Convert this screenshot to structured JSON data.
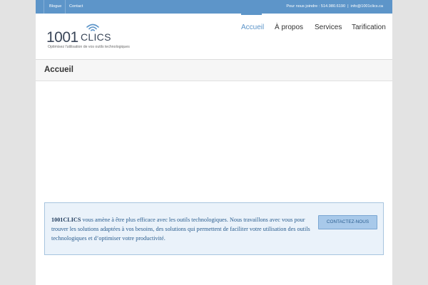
{
  "topbar": {
    "links": [
      "Blogue",
      "Contact"
    ],
    "phone_label": "Pour nous joindre : 514.980.6190",
    "separator": "|",
    "email": "info@1001clics.ca"
  },
  "logo": {
    "number": "1001",
    "word": "CLICS",
    "tagline": "Optimisez l'utilisation de vos outils technologiques"
  },
  "nav": {
    "items": [
      "Accueil",
      "À propos",
      "Services",
      "Tarification"
    ],
    "active_index": 0
  },
  "page": {
    "title": "Accueil"
  },
  "callout": {
    "brand": "1001CLICS",
    "text": " vous amène à être plus efficace avec les outils technologiques. Nous travaillons avec vous pour trouver les solutions adaptées à vos besoins, des solutions qui permettent de faciliter votre utilisation des outils technologiques et d’optimiser votre productivité.",
    "button_label": "CONTACTEZ-NOUS"
  },
  "colors": {
    "accent": "#5d95c9",
    "text": "#333333",
    "callout_bg": "#eaf2fa",
    "callout_text": "#2a5d8f"
  }
}
